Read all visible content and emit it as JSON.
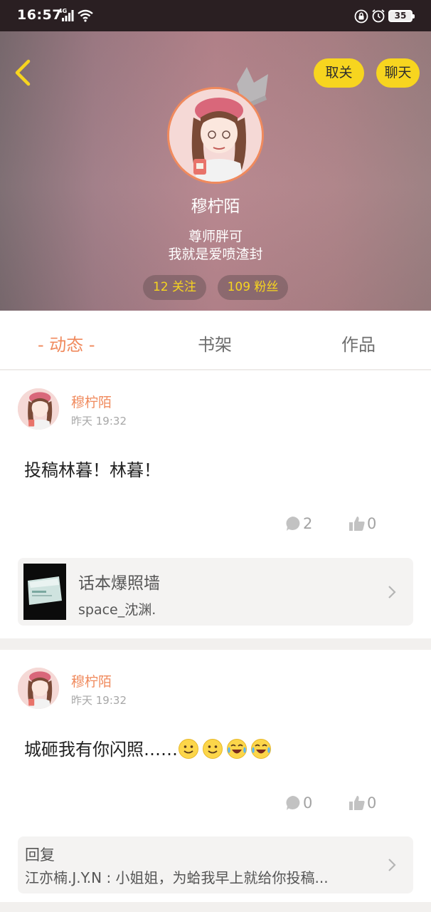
{
  "status_bar": {
    "time": "16:57",
    "network": "4G",
    "battery": "35",
    "icons": [
      "signal-icon",
      "wifi-icon",
      "lock-icon",
      "alarm-icon",
      "battery-icon"
    ]
  },
  "header": {
    "back_icon": "chevron-left-icon",
    "unfollow_label": "取关",
    "chat_label": "聊天",
    "username": "穆柠陌",
    "bio_line1": "尊师胖可",
    "bio_line2": "我就是爱喷渣封",
    "following": "12 关注",
    "fans": "109 粉丝",
    "accent": "#f7d51f"
  },
  "tabs": {
    "items": [
      {
        "label": "- 动态 -",
        "active": true
      },
      {
        "label": "书架",
        "active": false
      },
      {
        "label": "作品",
        "active": false
      }
    ],
    "active_color": "#f08a5d"
  },
  "posts": [
    {
      "author": "穆柠陌",
      "time": "昨天 19:32",
      "text": "投稿林暮！林暮！",
      "comments": "2",
      "likes": "0",
      "card": {
        "title": "话本爆照墙",
        "subtitle": "space_沈渊."
      }
    },
    {
      "author": "穆柠陌",
      "time": "昨天 19:32",
      "text": "城砸我有你闪照……",
      "emojis": [
        "smile-emoji",
        "smile-emoji",
        "laugh-cry-emoji",
        "laugh-cry-emoji"
      ],
      "comments": "0",
      "likes": "0",
      "reply": {
        "label": "回复",
        "text": "江亦楠.J.Y.N : 小姐姐，为蛤我早上就给你投稿..."
      }
    }
  ]
}
